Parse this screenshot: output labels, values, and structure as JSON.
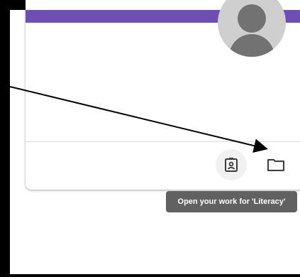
{
  "classroom_card": {
    "accent_color": "#6d4fb4",
    "avatar_icon": "account-avatar-icon",
    "actions": [
      {
        "icon": "assignment-portfolio-icon"
      },
      {
        "icon": "folder-icon"
      }
    ],
    "tooltip": "Open your work for 'Literacy'"
  },
  "annotation": {
    "type": "arrow",
    "color": "#000000"
  }
}
